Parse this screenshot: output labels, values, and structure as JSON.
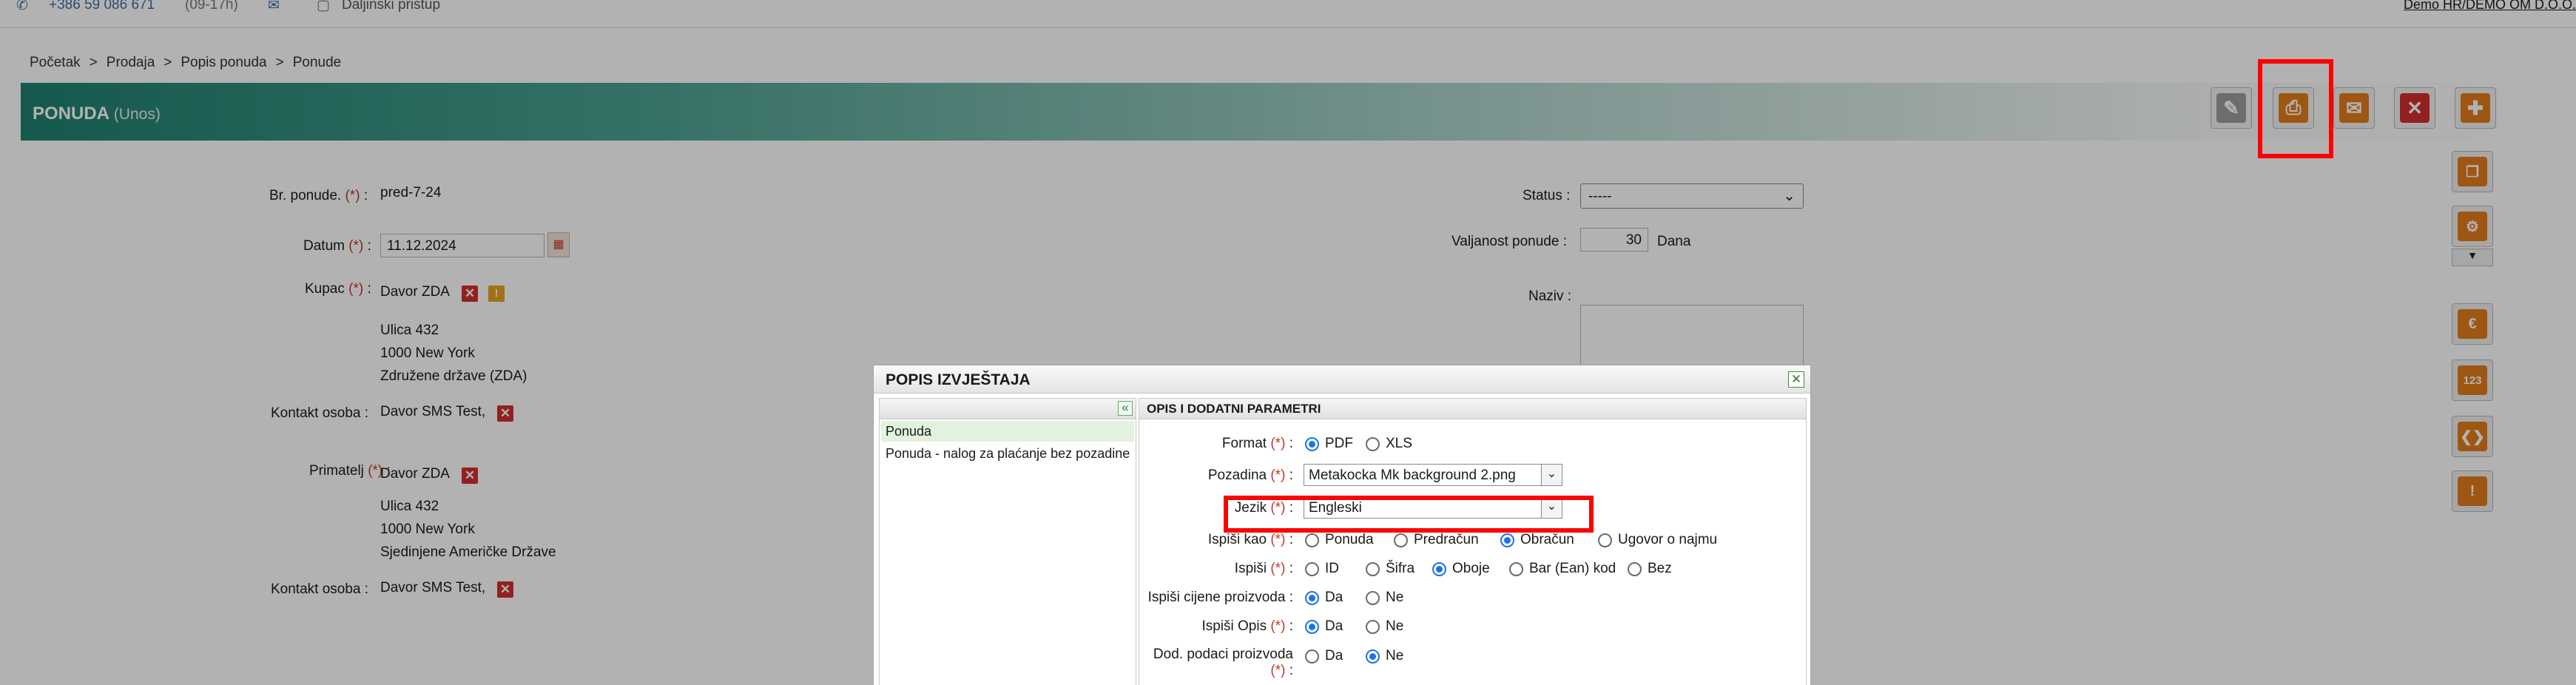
{
  "topbar": {
    "phone": "+386 59 086 671",
    "phone_hours": "(09-17h)",
    "remote": "Daljinski pristup",
    "company": "Demo HR/DEMO OM D.O.O."
  },
  "breadcrumb": [
    "Početak",
    "Prodaja",
    "Popis ponuda",
    "Ponude"
  ],
  "breadcrumb_sep": ">",
  "header": {
    "title": "PONUDA",
    "subtitle": "(Unos)"
  },
  "form": {
    "offer_no_label": "Br. ponude.",
    "offer_no": "pred-7-24",
    "date_label": "Datum",
    "date": "11.12.2024",
    "customer_label": "Kupac",
    "customer": "Davor ZDA",
    "customer_addr": [
      "Ulica 432",
      "1000 New York",
      "Združene države (ZDA)"
    ],
    "contact_label": "Kontakt osoba :",
    "contact": "Davor SMS Test,",
    "recipient_label": "Primatelj",
    "recipient": "Davor ZDA",
    "recipient_addr": [
      "Ulica 432",
      "1000 New York",
      "Sjedinjene Američke Države"
    ],
    "contact2_label": "Kontakt osoba :",
    "contact2": "Davor SMS Test,",
    "status_label": "Status :",
    "status_value": "-----",
    "validity_label": "Valjanost ponude :",
    "validity_days": "30",
    "validity_unit": "Dana",
    "naziv_label": "Naziv :",
    "req": "(*)"
  },
  "dialog": {
    "title": "POPIS IZVJEŠTAJA",
    "params_title": "OPIS I DODATNI PARAMETRI",
    "reports": [
      "Ponuda",
      "Ponuda - nalog za plaćanje bez pozadine"
    ],
    "format_label": "Format",
    "format_options": [
      "PDF",
      "XLS"
    ],
    "background_label": "Pozadina",
    "background_value": "Metakocka Mk background 2.png",
    "language_label": "Jezik",
    "language_value": "Engleski",
    "print_as_label": "Ispiši kao",
    "print_as_options": [
      "Ponuda",
      "Predračun",
      "Obračun",
      "Ugovor o najmu"
    ],
    "print_label": "Ispiši",
    "print_options": [
      "ID",
      "Šifra",
      "Oboje",
      "Bar (Ean) kod",
      "Bez"
    ],
    "prices_label": "Ispiši cijene proizvoda :",
    "desc_label": "Ispiši Opis",
    "extra_label": "Dod. podaci proizvoda",
    "yes": "Da",
    "no": "Ne",
    "colon": ":"
  },
  "colors": {
    "accent": "#1f8070",
    "danger": "#d32f2f",
    "orange": "#e37b1c",
    "highlight": "#ff0000"
  }
}
